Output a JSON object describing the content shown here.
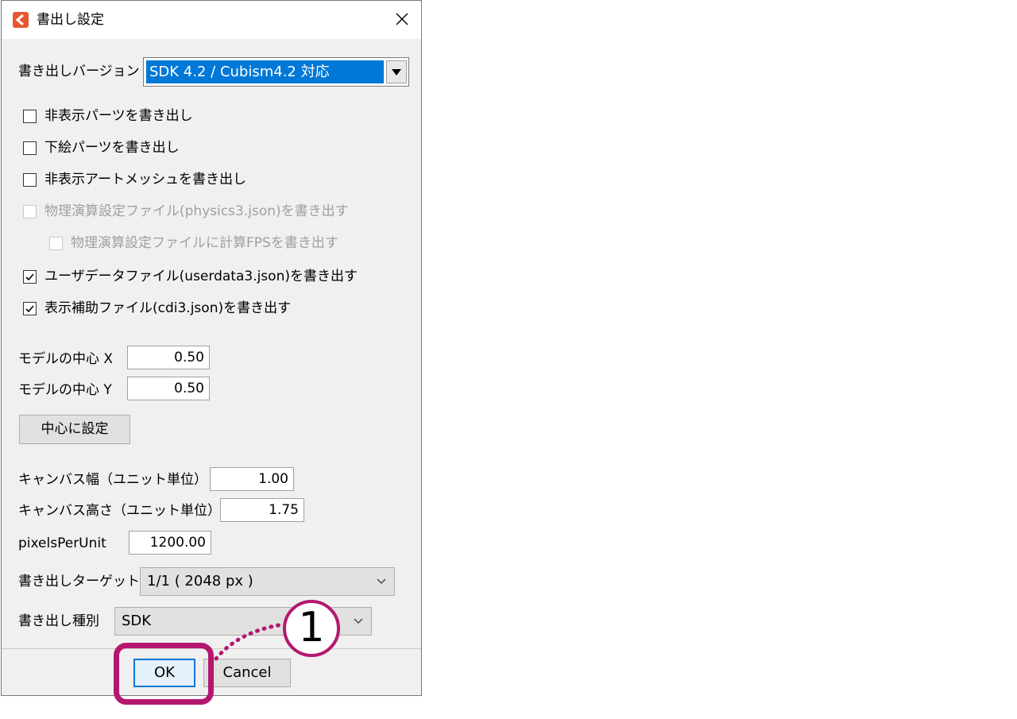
{
  "dialog": {
    "title": "書出し設定",
    "accent_color": "#e9562d"
  },
  "version": {
    "label": "書き出しバージョン",
    "selected": "SDK 4.2 / Cubism4.2 対応"
  },
  "checkboxes": [
    {
      "label": "非表示パーツを書き出し",
      "checked": false,
      "enabled": true
    },
    {
      "label": "下絵パーツを書き出し",
      "checked": false,
      "enabled": true
    },
    {
      "label": "非表示アートメッシュを書き出し",
      "checked": false,
      "enabled": true
    },
    {
      "label": "物理演算設定ファイル(physics3.json)を書き出す",
      "checked": false,
      "enabled": false
    },
    {
      "label": "物理演算設定ファイルに計算FPSを書き出す",
      "checked": false,
      "enabled": false
    },
    {
      "label": "ユーザデータファイル(userdata3.json)を書き出す",
      "checked": true,
      "enabled": true
    },
    {
      "label": "表示補助ファイル(cdi3.json)を書き出す",
      "checked": true,
      "enabled": true
    }
  ],
  "center": {
    "x_label": "モデルの中心 X",
    "x_value": "0.50",
    "y_label": "モデルの中心 Y",
    "y_value": "0.50",
    "set_button": "中心に設定"
  },
  "canvas": {
    "width_label": "キャンバス幅（ユニット単位）",
    "width_value": "1.00",
    "height_label": "キャンバス高さ（ユニット単位）",
    "height_value": "1.75",
    "ppu_label": "pixelsPerUnit",
    "ppu_value": "1200.00"
  },
  "target": {
    "label": "書き出しターゲット",
    "selected": "1/1 ( 2048 px )"
  },
  "kind": {
    "label": "書き出し種別",
    "selected": "SDK"
  },
  "footer": {
    "ok": "OK",
    "cancel": "Cancel"
  },
  "annotation": {
    "callout_number": "1",
    "highlight_color": "#b5176e"
  }
}
